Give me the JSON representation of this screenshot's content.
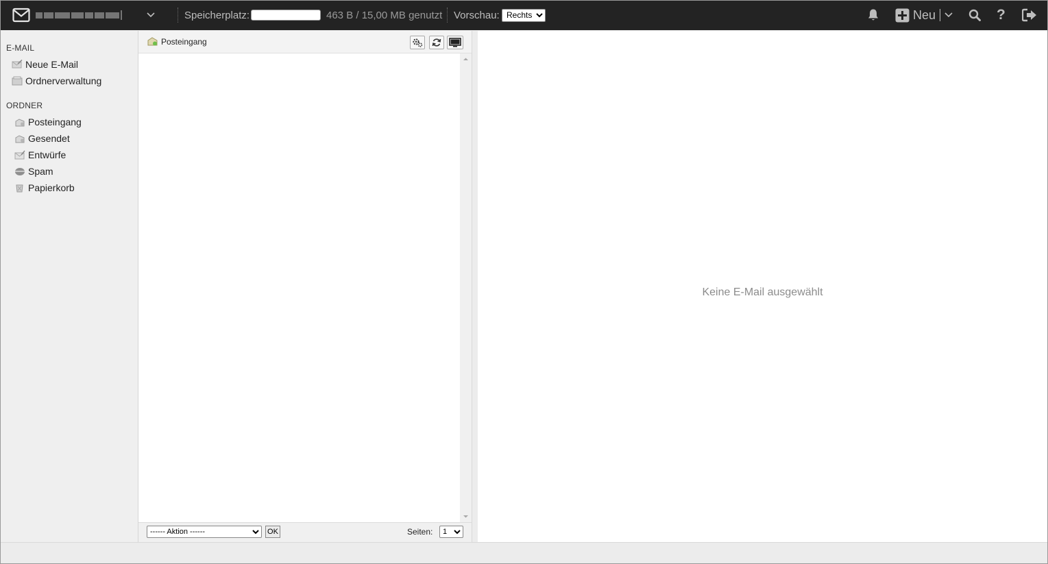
{
  "topbar": {
    "storage_label": "Speicherplatz:",
    "storage_used_fraction": 0.0,
    "storage_text": "463 B / 15,00 MB genutzt",
    "preview_label": "Vorschau:",
    "preview_selected": "Rechts",
    "new_label": "Neu"
  },
  "sidebar": {
    "section_email": "E-MAIL",
    "email_items": [
      {
        "label": "Neue E-Mail",
        "icon": "compose-mail-icon"
      },
      {
        "label": "Ordnerverwaltung",
        "icon": "folder-manage-icon"
      }
    ],
    "section_folders": "ORDNER",
    "folders": [
      {
        "label": "Posteingang",
        "icon": "inbox-icon"
      },
      {
        "label": "Gesendet",
        "icon": "sent-icon"
      },
      {
        "label": "Entwürfe",
        "icon": "drafts-icon"
      },
      {
        "label": "Spam",
        "icon": "spam-icon"
      },
      {
        "label": "Papierkorb",
        "icon": "trash-icon"
      }
    ]
  },
  "list": {
    "current_folder": "Posteingang",
    "action_selected": "------ Aktion ------",
    "ok_label": "OK",
    "pages_label": "Seiten:",
    "page_selected": "1"
  },
  "preview": {
    "empty_message": "Keine E-Mail ausgewählt"
  },
  "colors": {
    "topbar_bg": "#232323",
    "topbar_text": "#bdbdbd"
  }
}
